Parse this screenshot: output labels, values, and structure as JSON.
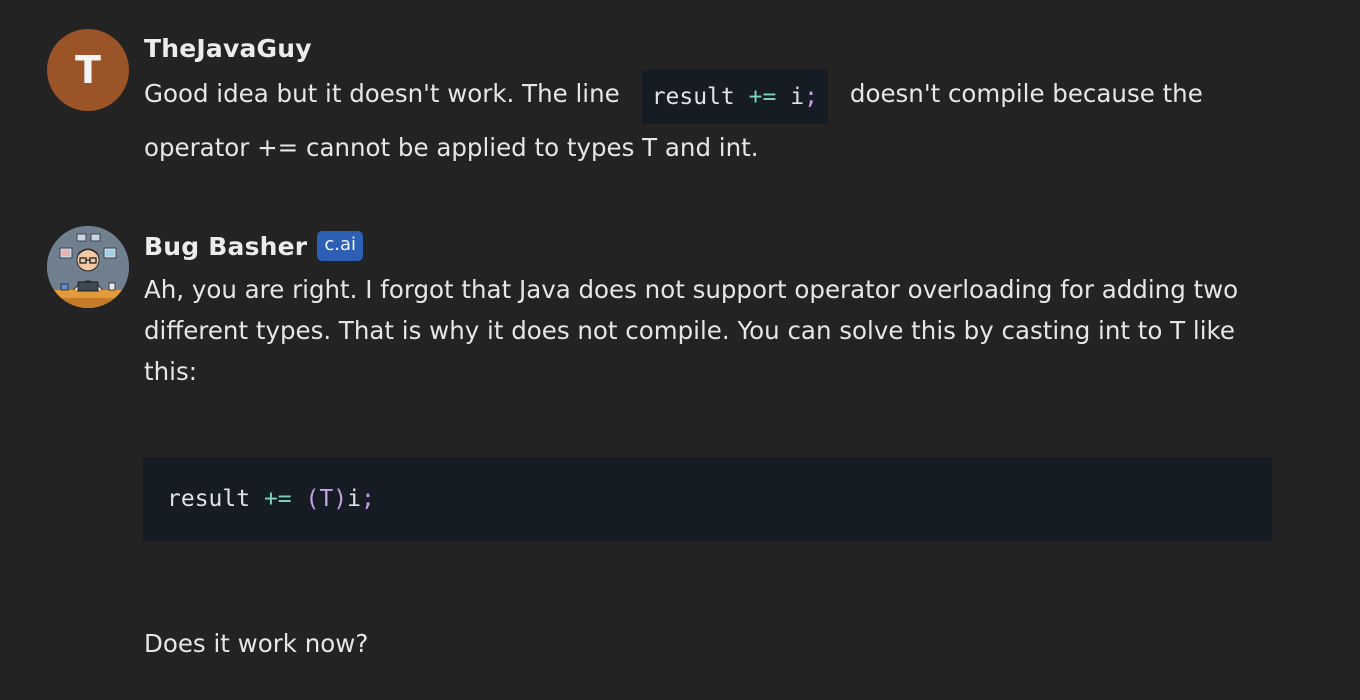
{
  "messages": [
    {
      "author": "TheJavaGuy",
      "avatar_letter": "T",
      "avatar_color": "#9a5427",
      "text_before_code": "Good idea but it doesn't work. The line",
      "inline_code": {
        "identifier": "result",
        "operator": "+=",
        "variable": "i",
        "terminator": ";"
      },
      "text_after_code_line1": "doesn't compile because the",
      "text_after_code_line2": "operator += cannot be applied to types T and int."
    },
    {
      "author": "Bug Basher",
      "badge": "c.ai",
      "badge_color": "#2d5fb5",
      "avatar_icon": "cartoon-programmer-avatar",
      "paragraph": "Ah, you are right. I forgot that Java does not support operator overloading for adding two different types. That is why it does not compile. You can solve this by casting int to T like this:",
      "code_block": {
        "identifier": "result",
        "operator": "+=",
        "cast_open": "(",
        "cast_type": "T",
        "cast_close": ")",
        "variable": "i",
        "terminator": ";"
      },
      "closing": "Does it work now?"
    }
  ]
}
